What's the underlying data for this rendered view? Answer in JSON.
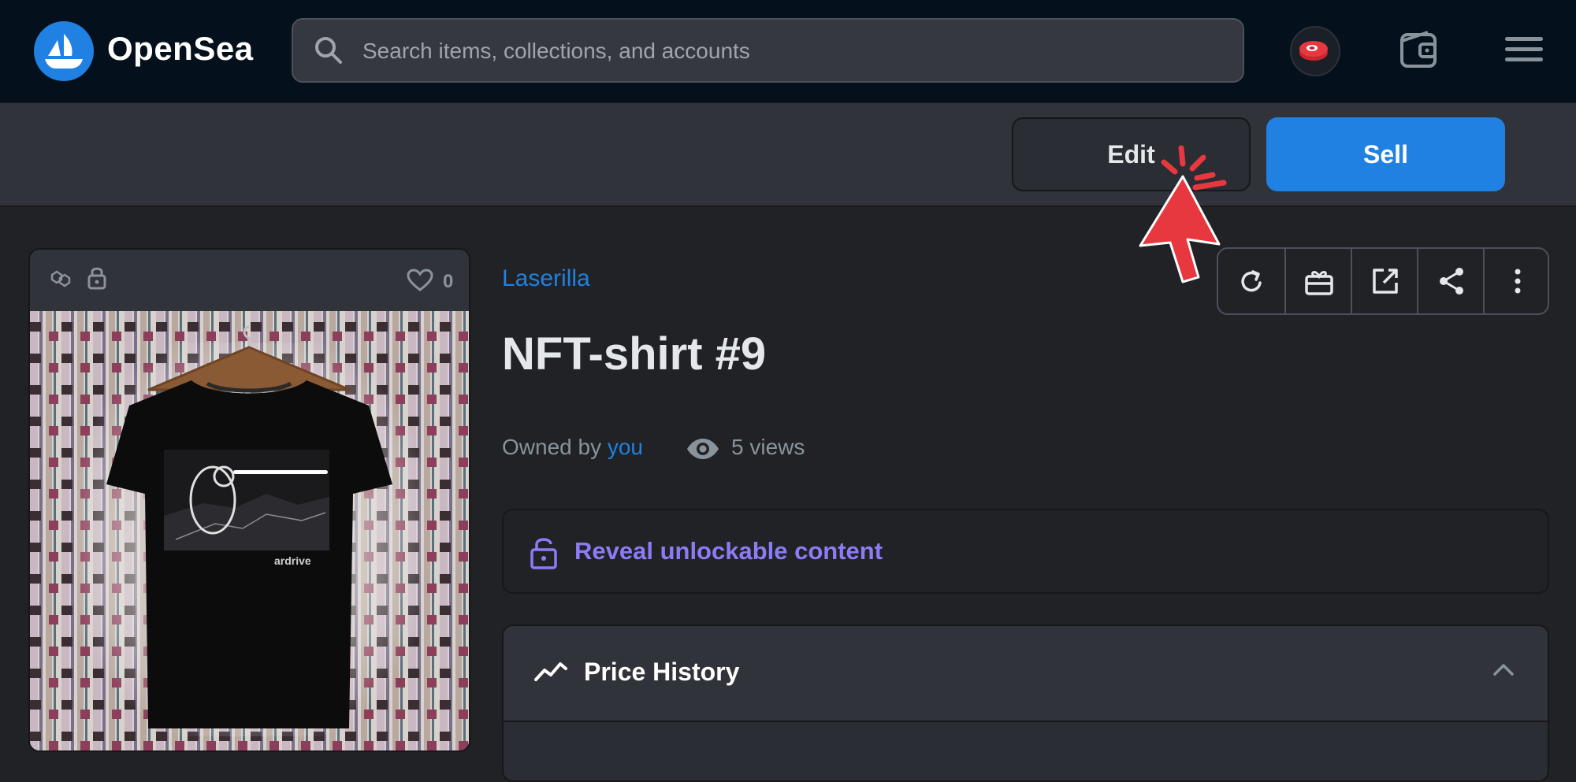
{
  "header": {
    "brand": "OpenSea",
    "search_placeholder": "Search items, collections, and accounts",
    "icons": [
      "opensea-logo-icon",
      "search-icon",
      "avatar-icon",
      "wallet-icon",
      "hamburger-menu-icon"
    ]
  },
  "actions": {
    "edit_label": "Edit",
    "sell_label": "Sell"
  },
  "card": {
    "likes": "0",
    "icons": [
      "polygon-chain-icon",
      "lock-icon",
      "heart-icon"
    ]
  },
  "item": {
    "collection": "Laserilla",
    "title": "NFT-shirt #9",
    "owned_by_prefix": "Owned by ",
    "owner": "you",
    "views": "5 views"
  },
  "toolbar": {
    "buttons": [
      "refresh-icon",
      "transfer-gift-icon",
      "external-link-icon",
      "share-icon",
      "more-options-icon"
    ]
  },
  "unlockable": {
    "label": "Reveal unlockable content"
  },
  "price_history": {
    "title": "Price History"
  },
  "colors": {
    "accent": "#2081e2",
    "header_bg": "#04111d",
    "page_bg": "#202225",
    "unlock_purple": "#8b7cf6",
    "cursor_red": "#e8383f"
  }
}
